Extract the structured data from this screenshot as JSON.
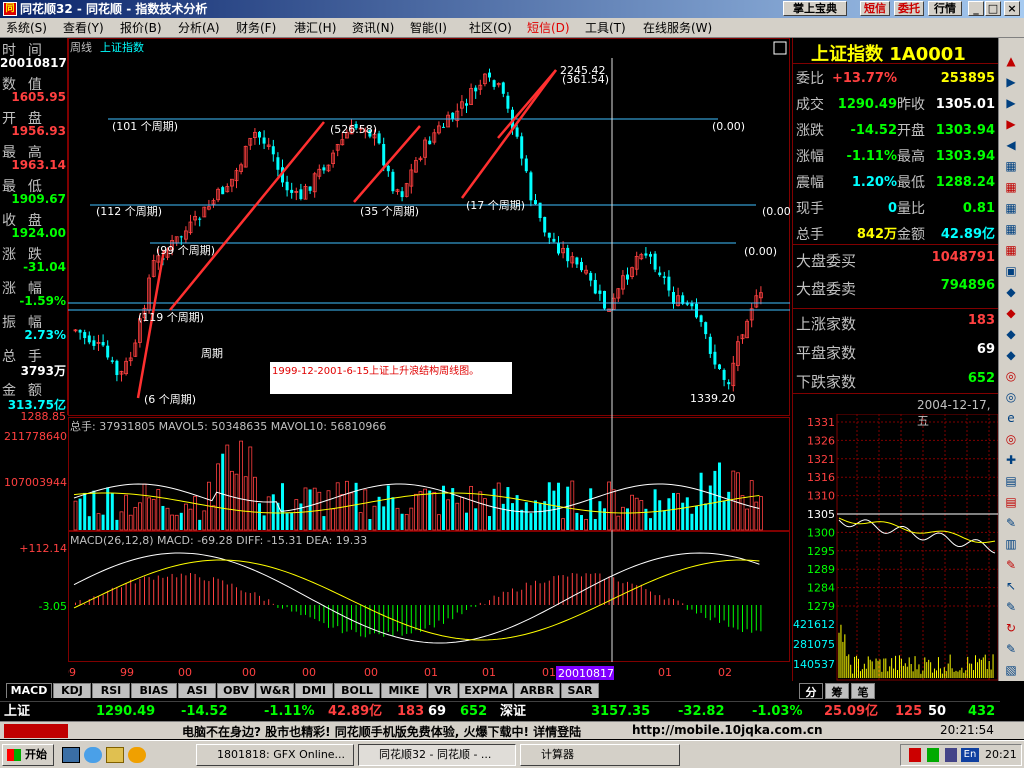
{
  "window": {
    "title": "同花顺32 - 同花顺 - 指数技术分析",
    "top_buttons": [
      "掌上宝典",
      "短信",
      "委托",
      "行情"
    ],
    "controls": [
      "_",
      "□",
      "×"
    ]
  },
  "menu": [
    "系统(S)",
    "查看(Y)",
    "报价(B)",
    "分析(A)",
    "财务(F)",
    "港汇(H)",
    "资讯(N)",
    "智能(I)",
    "社区(O)",
    "短信(D)",
    "工具(T)",
    "在线服务(W)"
  ],
  "left_panel": {
    "rows": [
      {
        "label": "时  间",
        "value": "20010817",
        "color": "#ffffff"
      },
      {
        "label": "数  值",
        "value": "1605.95",
        "color": "#ff4040"
      },
      {
        "label": "开  盘",
        "value": "1956.93",
        "color": "#ff4040"
      },
      {
        "label": "最  高",
        "value": "1963.14",
        "color": "#ff4040"
      },
      {
        "label": "最  低",
        "value": "1909.67",
        "color": "#00ff00"
      },
      {
        "label": "收  盘",
        "value": "1924.00",
        "color": "#00ff00"
      },
      {
        "label": "涨  跌",
        "value": "-31.04",
        "color": "#00ff00"
      },
      {
        "label": "涨  幅",
        "value": "-1.59%",
        "color": "#00ff00"
      },
      {
        "label": "振  幅",
        "value": "2.73%",
        "color": "#00ffff"
      },
      {
        "label": "总  手",
        "value": "3793万",
        "color": "#ffffff"
      },
      {
        "label": "金  额",
        "value": "313.75亿",
        "color": "#00ffff"
      }
    ]
  },
  "chart_header": {
    "period": "周线",
    "name": "上证指数"
  },
  "annotations": {
    "cycles": [
      "(101 个周期)",
      "(112 个周期)",
      "(35 个周期)",
      "(17 个周期)",
      "(6 个周期)",
      "(119 个周期)",
      "(99 个周期)",
      "(526.58)",
      "(361.54)",
      "2245.42",
      "(0.00)",
      "(0.00)",
      "(0.00)",
      "1339.20"
    ],
    "note": "1999-12-2001-6-15上证上升浪结构周线图。",
    "price_low_label": "1288.85"
  },
  "volume_panel": {
    "header": "总手: 37931805 MAVOL5: 50348635 MAVOL10: 56810966",
    "axis": [
      "211778640",
      "107003944"
    ]
  },
  "macd_panel": {
    "header": "MACD(26,12,8) MACD: -69.28 DIFF: -15.31 DEA: 19.33",
    "axis": [
      "+112.14",
      "-3.05"
    ]
  },
  "x_axis": [
    "99",
    "99",
    "00",
    "00",
    "00",
    "00",
    "01",
    "01",
    "01",
    "01",
    "02"
  ],
  "x_cursor_label": "20010817",
  "tabs": [
    "MACD",
    "KDJ",
    "RSI",
    "BIAS",
    "ASI",
    "OBV",
    "W&R",
    "DMI",
    "BOLL",
    "MIKE",
    "VR",
    "EXPMA",
    "ARBR",
    "SAR"
  ],
  "right_panel": {
    "title": "上证指数 1A0001",
    "rows": [
      {
        "l1": "委比",
        "v1": "+13.77%",
        "c1": "#ff4040",
        "l2": "",
        "v2": "253895",
        "c2": "#ffff00"
      },
      {
        "l1": "成交",
        "v1": "1290.49",
        "c1": "#00ff00",
        "l2": "昨收",
        "v2": "1305.01",
        "c2": "#ffffff"
      },
      {
        "l1": "涨跌",
        "v1": "-14.52",
        "c1": "#00ff00",
        "l2": "开盘",
        "v2": "1303.94",
        "c2": "#00ff00"
      },
      {
        "l1": "涨幅",
        "v1": "-1.11%",
        "c1": "#00ff00",
        "l2": "最高",
        "v2": "1303.94",
        "c2": "#00ff00"
      },
      {
        "l1": "震幅",
        "v1": "1.20%",
        "c1": "#00ffff",
        "l2": "最低",
        "v2": "1288.24",
        "c2": "#00ff00"
      },
      {
        "l1": "现手",
        "v1": "0",
        "c1": "#00ffff",
        "l2": "量比",
        "v2": "0.81",
        "c2": "#00ff00"
      },
      {
        "l1": "总手",
        "v1": "842万",
        "c1": "#ffff00",
        "l2": "金额",
        "v2": "42.89亿",
        "c2": "#00ffff"
      }
    ],
    "big_rows": [
      {
        "l": "大盘委买",
        "v": "1048791",
        "c": "#ff4040"
      },
      {
        "l": "大盘委卖",
        "v": "794896",
        "c": "#00ff00"
      }
    ],
    "count_rows": [
      {
        "l": "上涨家数",
        "v": "183",
        "c": "#ff4040"
      },
      {
        "l": "平盘家数",
        "v": "69",
        "c": "#ffffff"
      },
      {
        "l": "下跌家数",
        "v": "652",
        "c": "#00ff00"
      }
    ],
    "date": "2004-12-17,五",
    "minute_axis": [
      "1331",
      "1326",
      "1321",
      "1316",
      "1310",
      "1305",
      "1300",
      "1295",
      "1289",
      "1284",
      "1279"
    ],
    "vol_axis": [
      "421612",
      "281075",
      "140537"
    ],
    "mini_tabs": [
      "分",
      "筹",
      "笔"
    ]
  },
  "ticker": {
    "sh_name": "上证",
    "sh_price": "1290.49",
    "sh_chg": "-14.52",
    "sh_pct": "-1.11%",
    "sh_amt": "42.89亿",
    "sh_up": "183",
    "sh_flat": "69",
    "sh_down": "652",
    "sz_name": "深证",
    "sz_price": "3157.35",
    "sz_chg": "-32.82",
    "sz_pct": "-1.03%",
    "sz_amt": "25.09亿",
    "sz_up": "125",
    "sz_flat": "50",
    "sz_down": "432"
  },
  "news": {
    "text": "电脑不在身边? 股市也精彩! 同花顺手机版免费体验, 火爆下载中! 详情登陆",
    "url": "http://mobile.10jqka.com.cn",
    "time": "20:21:54"
  },
  "taskbar": {
    "start": "开始",
    "tasks": [
      "1801818: GFX Online...",
      "同花顺32 - 同花顺 - ...",
      "计算器"
    ],
    "lang": "En",
    "clock": "20:21"
  },
  "colors": {
    "up": "#ff4040",
    "down": "#00ffff",
    "bg": "#000000",
    "trend": "#ff3030"
  }
}
